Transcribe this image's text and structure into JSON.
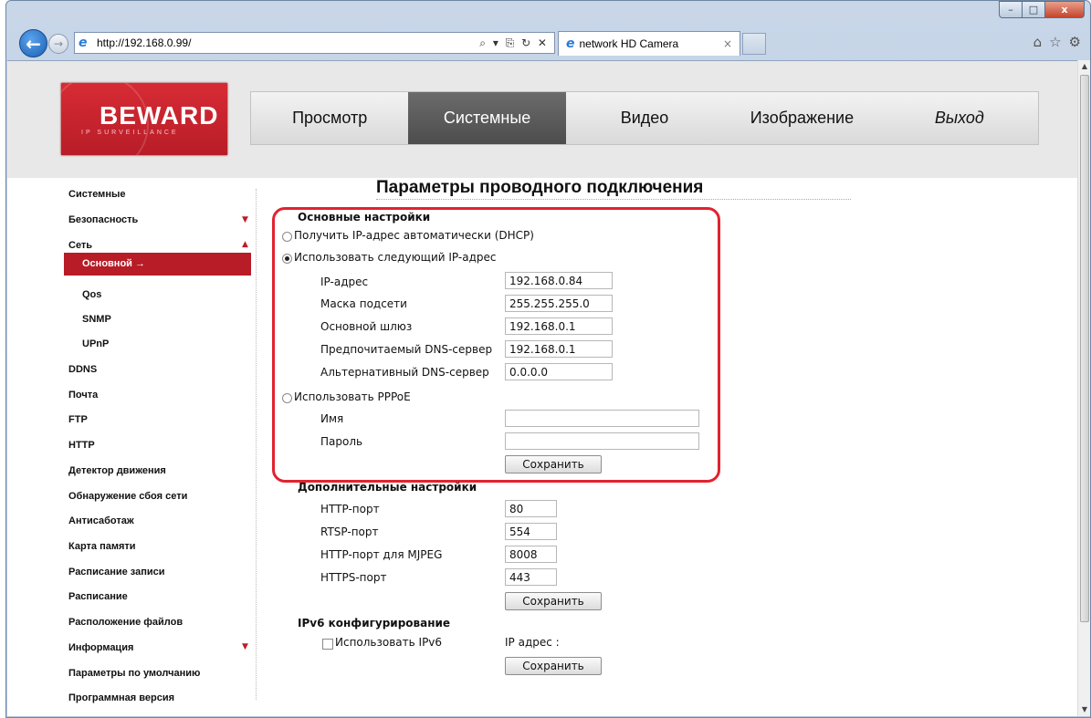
{
  "browser": {
    "url": "http://192.168.0.99/",
    "tab_title": "network HD Camera",
    "tab_close": "×",
    "address_tools": "⌕ ▾ ⎘ ↻ ✕",
    "back_icon": "←",
    "forward_icon": "→",
    "window_controls": {
      "minimize": "–",
      "maximize": "□",
      "close": "x"
    },
    "right_icons": [
      "⌂",
      "☆",
      "⚙"
    ]
  },
  "logo": {
    "text": "BEWARD",
    "subtitle": "IP SURVEILLANCE"
  },
  "top_nav": [
    {
      "label": "Просмотр",
      "active": false,
      "italic": false
    },
    {
      "label": "Системные",
      "active": true,
      "italic": false
    },
    {
      "label": "Видео",
      "active": false,
      "italic": false
    },
    {
      "label": "Изображение",
      "active": false,
      "italic": false
    },
    {
      "label": "Выход",
      "active": false,
      "italic": true
    }
  ],
  "sidebar": {
    "items": [
      {
        "label": "Системные"
      },
      {
        "label": "Безопасность",
        "arrow": "▼"
      },
      {
        "label": "Сеть",
        "arrow": "▲"
      },
      {
        "label": "Основной →",
        "active": true
      },
      {
        "label": "Qos",
        "sub": true
      },
      {
        "label": "SNMP",
        "sub": true
      },
      {
        "label": "UPnP",
        "sub": true
      },
      {
        "label": "DDNS"
      },
      {
        "label": "Почта"
      },
      {
        "label": "FTP"
      },
      {
        "label": "HTTP"
      },
      {
        "label": "Детектор движения"
      },
      {
        "label": "Обнаружение сбоя сети"
      },
      {
        "label": "Антисаботаж"
      },
      {
        "label": "Карта памяти"
      },
      {
        "label": "Расписание записи"
      },
      {
        "label": "Расписание"
      },
      {
        "label": "Расположение файлов"
      },
      {
        "label": "Информация",
        "arrow": "▼"
      },
      {
        "label": "Параметры по умолчанию"
      },
      {
        "label": "Программная версия"
      }
    ]
  },
  "main": {
    "title": "Параметры проводного подключения",
    "basic": {
      "title": "Основные настройки",
      "dhcp_label": "Получить IP-адрес автоматически (DHCP)",
      "static_label": "Использовать следующий IP-адрес",
      "ip_label": "IP-адрес",
      "ip_value": "192.168.0.84",
      "mask_label": "Маска подсети",
      "mask_value": "255.255.255.0",
      "gateway_label": "Основной шлюз",
      "gateway_value": "192.168.0.1",
      "dns1_label": "Предпочитаемый DNS-сервер",
      "dns1_value": "192.168.0.1",
      "dns2_label": "Альтернативный DNS-сервер",
      "dns2_value": "0.0.0.0",
      "pppoe_label": "Использовать PPPoE",
      "name_label": "Имя",
      "name_value": "",
      "password_label": "Пароль",
      "password_value": "",
      "save_label": "Сохранить"
    },
    "advanced": {
      "title": "Дополнительные настройки",
      "http_label": "HTTP-порт",
      "http_value": "80",
      "rtsp_label": "RTSP-порт",
      "rtsp_value": "554",
      "mjpeg_label": "HTTP-порт для MJPEG",
      "mjpeg_value": "8008",
      "https_label": "HTTPS-порт",
      "https_value": "443",
      "save_label": "Сохранить"
    },
    "ipv6": {
      "title": "IPv6 конфигурирование",
      "use_label": "Использовать IPv6",
      "ip_label": "IP адрес :",
      "save_label": "Сохранить"
    }
  },
  "colors": {
    "accent": "#b71c27",
    "highlight": "#e1232f",
    "header_bg": "#e8e8e8"
  }
}
